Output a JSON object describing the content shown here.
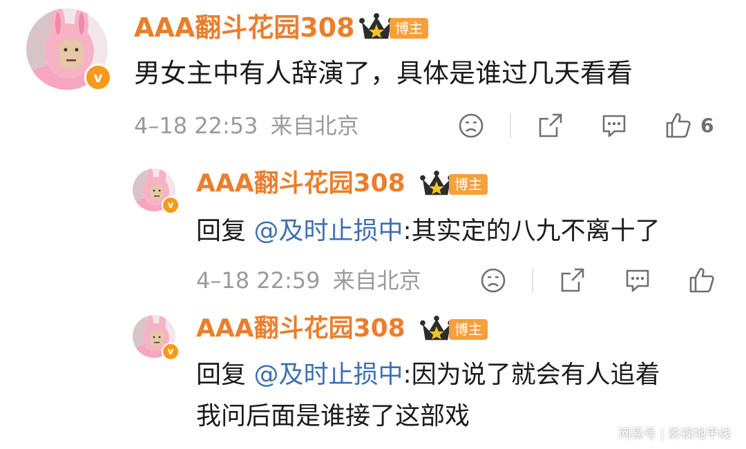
{
  "colors": {
    "username": "#eb7e2c",
    "mention": "#3e6fb0",
    "meta": "#9a9a9a",
    "badge": "#f5a03a",
    "verified": "#f59a1b"
  },
  "comments": [
    {
      "username": "AAA翻斗花园308",
      "badge": "博主",
      "verified_icon": "v",
      "text": "男女主中有人辞演了，具体是谁过几天看看",
      "time": "4–18 22:53",
      "location": "来自北京",
      "likes": "6",
      "icons": [
        "dislike-face-icon",
        "share-icon",
        "comment-icon",
        "thumbs-up-icon"
      ]
    },
    {
      "username": "AAA翻斗花园308",
      "badge": "博主",
      "verified_icon": "v",
      "reply_prefix": "回复",
      "mention": "@及时止损中",
      "text": ":其实定的八九不离十了",
      "time": "4–18 22:59",
      "location": "来自北京"
    },
    {
      "username": "AAA翻斗花园308",
      "badge": "博主",
      "verified_icon": "v",
      "reply_prefix": "回复",
      "mention": "@及时止损中",
      "text": ":因为说了就会有人追着",
      "text_line2": "我问后面是谁接了这部戏"
    }
  ],
  "watermark": {
    "source": "网易号",
    "separator": "|",
    "author": "影视地平线"
  }
}
